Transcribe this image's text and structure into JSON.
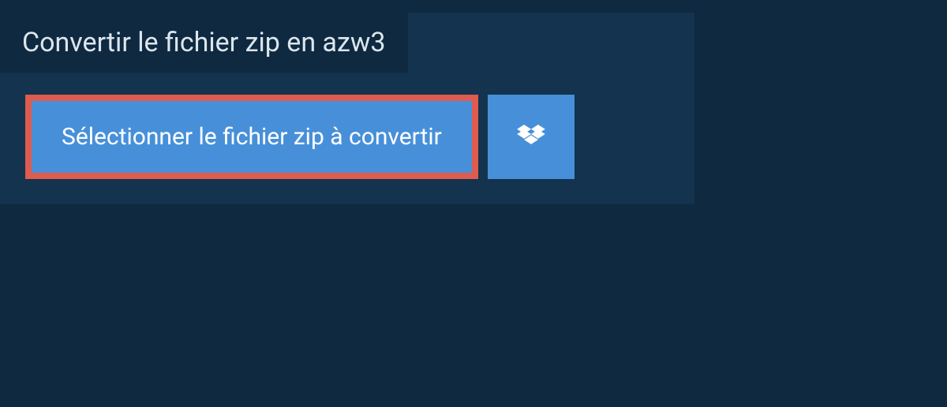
{
  "header": {
    "title": "Convertir le fichier zip en azw3"
  },
  "actions": {
    "select_label": "Sélectionner le fichier zip à convertir",
    "dropbox_icon": "dropbox"
  }
}
